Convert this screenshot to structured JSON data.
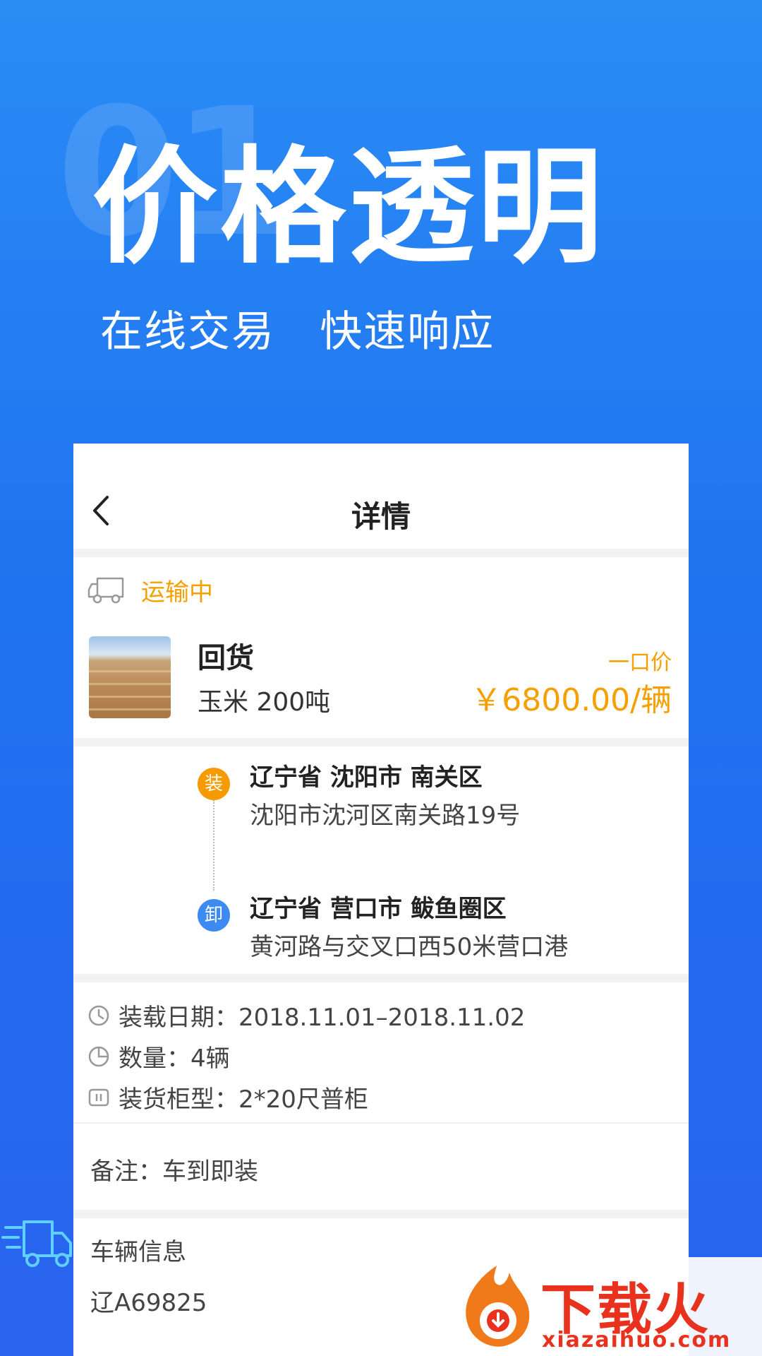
{
  "hero": {
    "number": "01",
    "title": "价格透明",
    "subtitle": "在线交易   快速响应"
  },
  "nav": {
    "title": "详情"
  },
  "status": {
    "text": "运输中",
    "color": "#f5a000"
  },
  "goods": {
    "title": "回货",
    "desc": "玉米 200吨",
    "price_label": "一口价",
    "price": "￥6800.00/辆"
  },
  "route": {
    "load_badge": "装",
    "load_main": "辽宁省 沈阳市 南关区",
    "load_sub": "沈阳市沈河区南关路19号",
    "unload_badge": "卸",
    "unload_main": "辽宁省 营口市 鲅鱼圈区",
    "unload_sub": "黄河路与交叉口西50米营口港"
  },
  "info": {
    "date": "装载日期：2018.11.01–2018.11.02",
    "quantity": "数量：4辆",
    "container": "装货柜型：2*20尺普柜",
    "note": "备注：车到即装"
  },
  "vehicle": {
    "label": "车辆信息",
    "plate": "辽A69825"
  },
  "watermark": {
    "name": "下载火",
    "url": "xiazaihuo.com"
  },
  "colors": {
    "accent_orange": "#f5a000",
    "badge_orange": "#f59a00",
    "badge_blue": "#3d8bf2",
    "brand_blue": "#1f72f0"
  }
}
